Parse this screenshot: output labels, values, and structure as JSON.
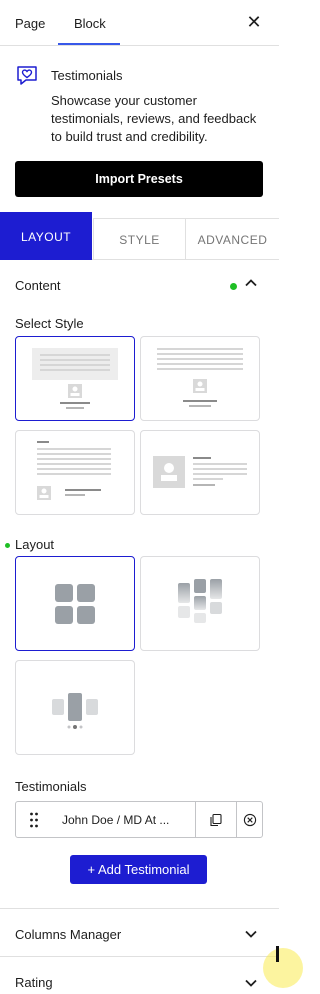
{
  "tabs": {
    "page": "Page",
    "block": "Block"
  },
  "block": {
    "title": "Testimonials",
    "description": "Showcase your customer testimonials, reviews, and feedback to build trust and credibility."
  },
  "import_button": "Import Presets",
  "subtabs": {
    "layout": "LAYOUT",
    "style": "STYLE",
    "advanced": "ADVANCED"
  },
  "content": {
    "heading": "Content",
    "select_style_label": "Select Style",
    "layout_label": "Layout",
    "testimonials_label": "Testimonials",
    "testimonial_item": "John Doe / MD At ...",
    "add_button": "+ Add Testimonial"
  },
  "panels": {
    "columns_manager": "Columns Manager",
    "rating": "Rating"
  },
  "colors": {
    "accent": "#1d1dd1",
    "tab_underline": "#3858e9",
    "status_dot": "#1fbf25",
    "import_bg": "#000000"
  },
  "icons": {
    "close": "close-icon",
    "block": "heart-chat-icon",
    "collapse": "chevron-up-icon",
    "expand": "chevron-down-icon",
    "drag": "drag-handle-icon",
    "duplicate": "copy-icon",
    "remove": "remove-circle-icon"
  }
}
